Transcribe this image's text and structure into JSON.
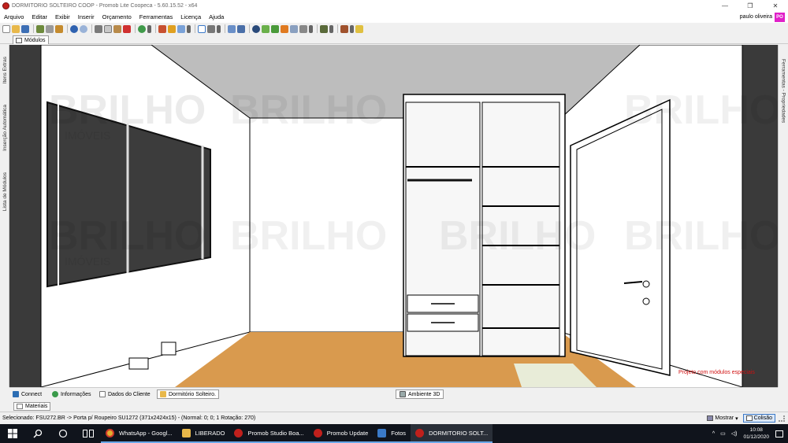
{
  "window": {
    "title": "DORMITORIO SOLTEIRO COOP - Promob Lite Coopeca - 5.60.15.52 - x64",
    "controls": [
      "—",
      "❐",
      "✕"
    ]
  },
  "menu": {
    "items": [
      "Arquivo",
      "Editar",
      "Exibir",
      "Inserir",
      "Orçamento",
      "Ferramentas",
      "Licença",
      "Ajuda"
    ],
    "user_name": "paulo oliveira",
    "avatar_initials": "PO"
  },
  "modules_tab": {
    "label": "Módulos"
  },
  "side_left": {
    "tabs": [
      "Itens Extras",
      "Inserção Automática",
      "Lista de Módulos"
    ]
  },
  "side_right": {
    "tabs": [
      "Ferramentas - Propriedades"
    ]
  },
  "viewport": {
    "note": "Projeto com módulos especiais",
    "watermark_top": "BRILHO",
    "watermark_sub": "IMÓVEIS",
    "scroll_arrow": "▶"
  },
  "bottom_tabs": {
    "items": [
      "Connect",
      "Informações",
      "Dados do Cliente",
      "Dormitório Solteiro."
    ],
    "view_tab": "Ambiente 3D"
  },
  "materials_tab": {
    "label": "Materiais"
  },
  "status": {
    "selected": "Selecionado: FSU272.BR -> Porta  p/ Roupeiro SU1272 (371x2424x15) - (Normal: 0; 0; 1 Rotação: 270)",
    "show_label": "Mostrar",
    "collision_label": "Colisão"
  },
  "taskbar": {
    "apps": [
      "WhatsApp - Googl...",
      "LIBERADO",
      "Promob Studio Boa...",
      "Promob Update",
      "Fotos",
      "DORMITORIO SOLT..."
    ],
    "time": "10:08",
    "date": "01/12/2020",
    "tray_symbols": [
      "^",
      "▭",
      "◁)"
    ]
  },
  "colors": {
    "accent": "#3a78c8",
    "avatar": "#e020c8",
    "note_red": "#d01010",
    "floor": "#d99a4e",
    "ceiling": "#bdbdbd",
    "window_glass": "#3c3c3c",
    "taskbar": "#10141c"
  }
}
